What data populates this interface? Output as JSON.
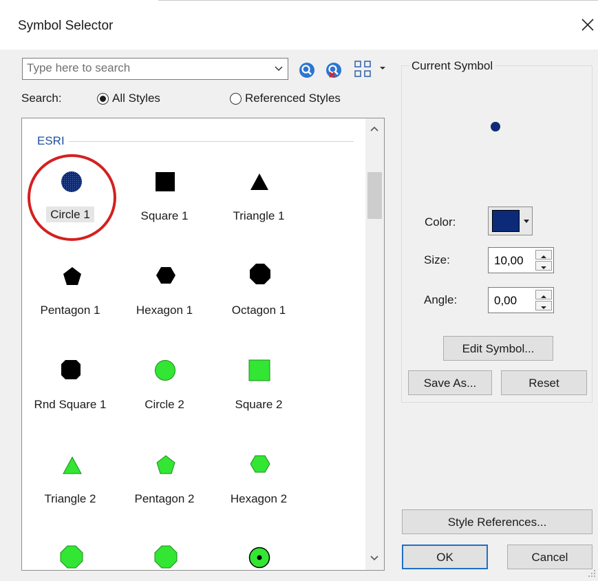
{
  "window": {
    "title": "Symbol Selector"
  },
  "search": {
    "placeholder": "Type here to search",
    "label": "Search:",
    "options": [
      "All Styles",
      "Referenced Styles"
    ],
    "selected": "All Styles"
  },
  "toolbar": {
    "icons": [
      "search-icon",
      "clear-search-icon",
      "view-options-icon"
    ]
  },
  "symbols": {
    "group_label": "ESRI",
    "items": [
      {
        "label": "Circle 1",
        "shape": "circle",
        "fill": "#0c2a78",
        "style": "dotted"
      },
      {
        "label": "Square 1",
        "shape": "square",
        "fill": "#000000"
      },
      {
        "label": "Triangle 1",
        "shape": "triangle",
        "fill": "#000000"
      },
      {
        "label": "Pentagon 1",
        "shape": "pentagon",
        "fill": "#000000"
      },
      {
        "label": "Hexagon 1",
        "shape": "hexagon",
        "fill": "#000000"
      },
      {
        "label": "Octagon 1",
        "shape": "octagon",
        "fill": "#000000"
      },
      {
        "label": "Rnd Square 1",
        "shape": "rnd-square",
        "fill": "#000000"
      },
      {
        "label": "Circle 2",
        "shape": "circle",
        "fill": "#33e633"
      },
      {
        "label": "Square 2",
        "shape": "square",
        "fill": "#33e633"
      },
      {
        "label": "Triangle 2",
        "shape": "triangle",
        "fill": "#33e633"
      },
      {
        "label": "Pentagon 2",
        "shape": "pentagon",
        "fill": "#33e633"
      },
      {
        "label": "Hexagon 2",
        "shape": "hexagon",
        "fill": "#33e633"
      },
      {
        "shape": "octagon",
        "fill": "#33e633"
      },
      {
        "shape": "octagon",
        "fill": "#33e633"
      },
      {
        "shape": "bullseye",
        "fill": "#33e633"
      }
    ],
    "selected": "Circle 1"
  },
  "current_symbol": {
    "legend": "Current Symbol",
    "color_label": "Color:",
    "color_value": "#0c2a78",
    "size_label": "Size:",
    "size_value": "10,00",
    "angle_label": "Angle:",
    "angle_value": "0,00"
  },
  "buttons": {
    "edit_symbol": "Edit Symbol...",
    "save_as": "Save As...",
    "reset": "Reset",
    "style_references": "Style References...",
    "ok": "OK",
    "cancel": "Cancel"
  }
}
